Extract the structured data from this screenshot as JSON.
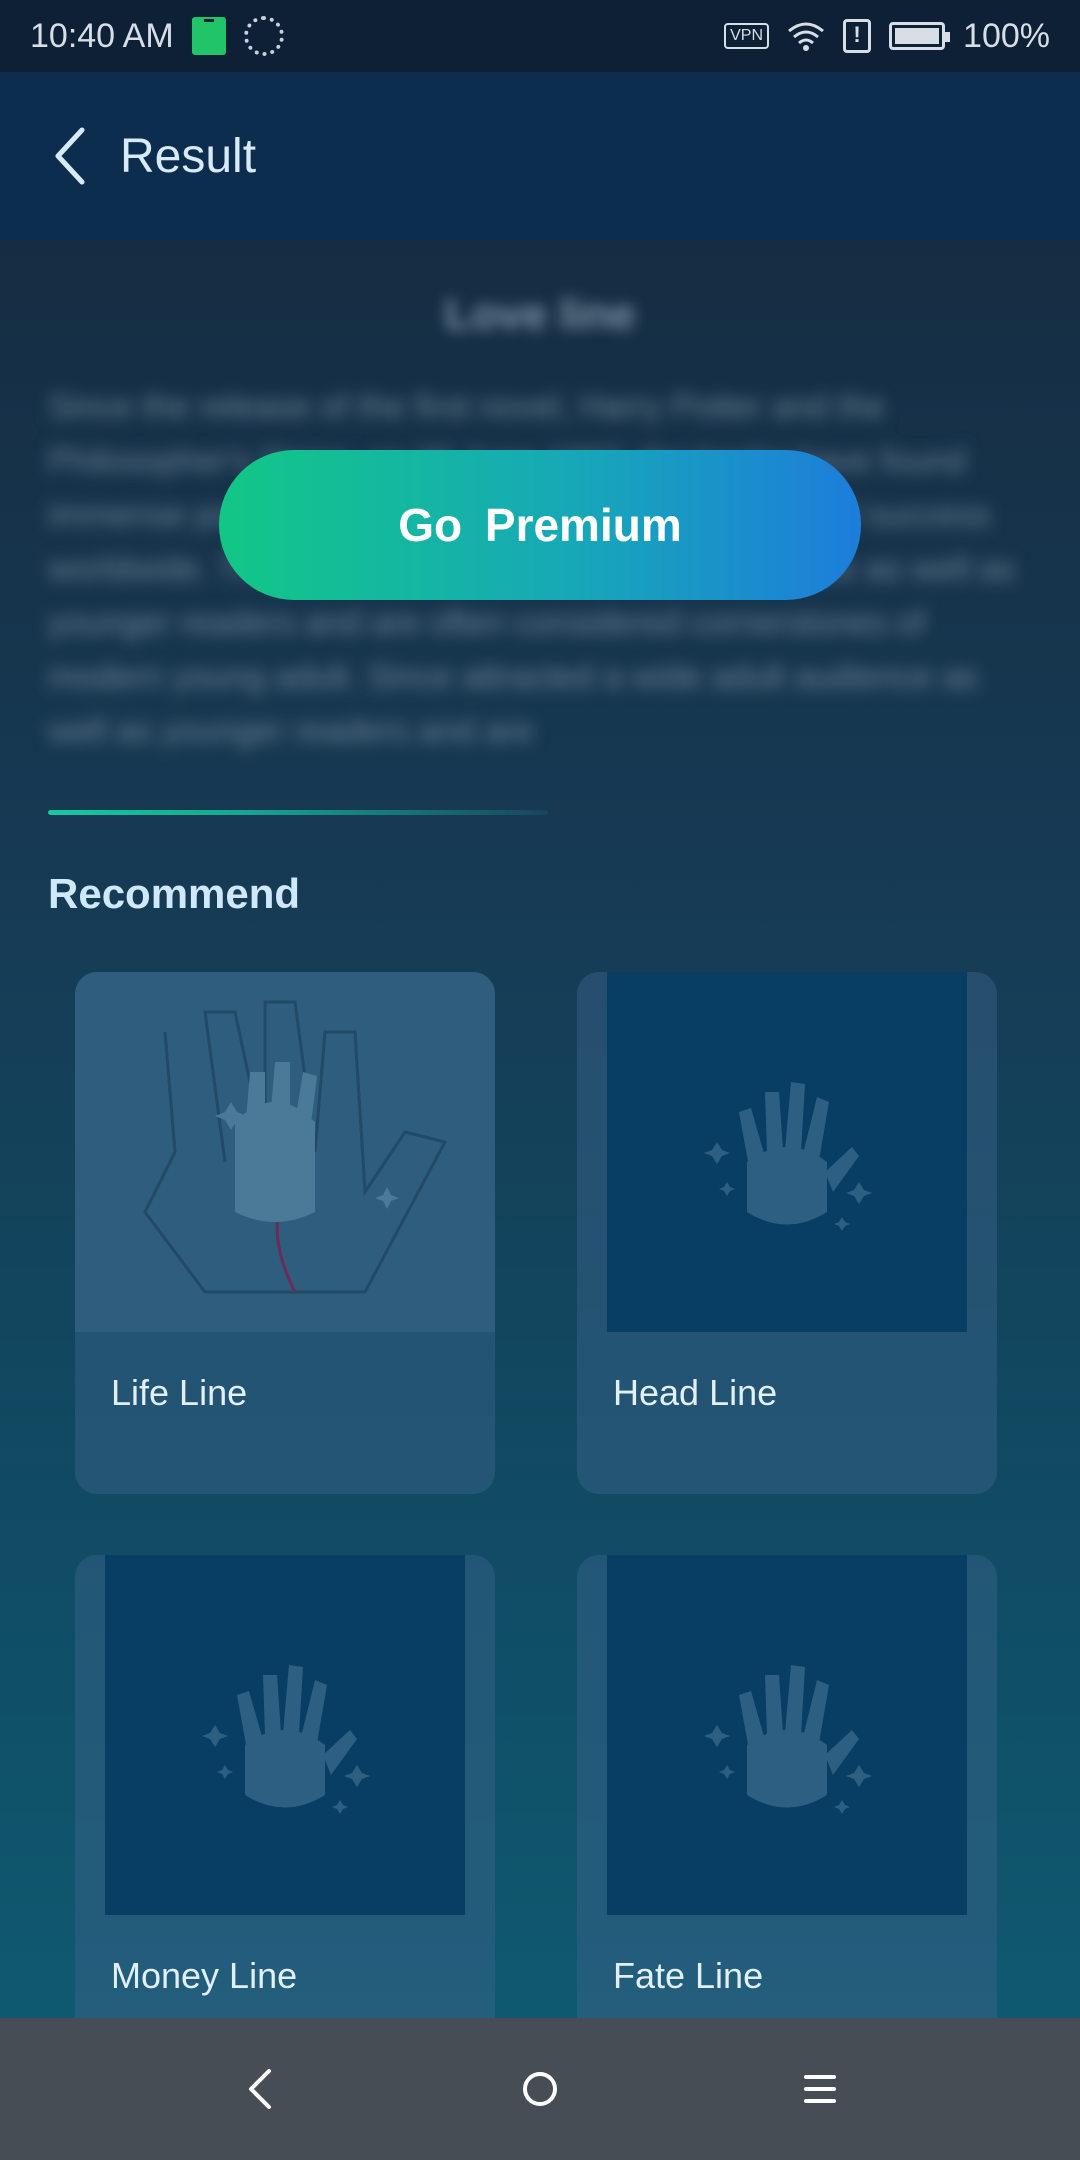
{
  "status_bar": {
    "time": "10:40 AM",
    "vpn": "VPN",
    "alert": "!",
    "battery": "100%"
  },
  "app_bar": {
    "title": "Result"
  },
  "locked_content": {
    "title": "Love line",
    "text": "Since the release of the first novel, Harry Potter and the Philosopher's Stone, on 26 June 1997, the books have found immense popularity, positive reviews, and commercial success worldwide. They have attracted a wide adult audience as well as younger readers and are often considered cornerstones of modern young adult. Since attracted a wide adult audience as well as younger readers and are"
  },
  "premium": {
    "button_label": "Go  Premium"
  },
  "recommend": {
    "title": "Recommend",
    "items": [
      {
        "label": "Life Line"
      },
      {
        "label": "Head Line"
      },
      {
        "label": "Money Line"
      },
      {
        "label": "Fate Line"
      }
    ]
  },
  "colors": {
    "accent_start": "#12c786",
    "accent_end": "#1d7ddb",
    "app_bar": "#0c2d4e",
    "nav_bar": "#474d54"
  }
}
